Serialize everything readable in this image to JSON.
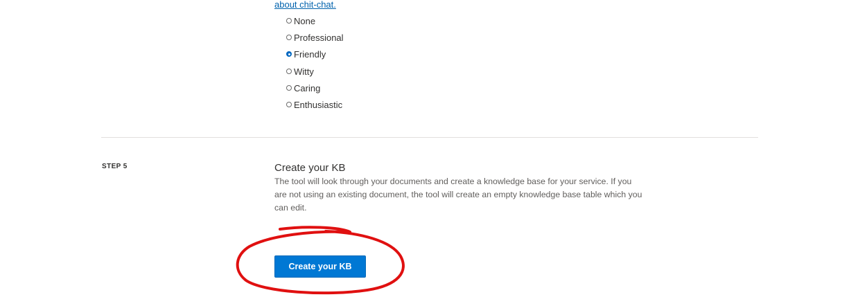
{
  "chit_chat": {
    "link_text": "about chit-chat.",
    "options": [
      {
        "label": "None",
        "checked": false
      },
      {
        "label": "Professional",
        "checked": false
      },
      {
        "label": "Friendly",
        "checked": true
      },
      {
        "label": "Witty",
        "checked": false
      },
      {
        "label": "Caring",
        "checked": false
      },
      {
        "label": "Enthusiastic",
        "checked": false
      }
    ]
  },
  "step5": {
    "step_label": "STEP 5",
    "title": "Create your KB",
    "description": "The tool will look through your documents and create a knowledge base for your service. If you are not using an existing document, the tool will create an empty knowledge base table which you can edit.",
    "button_label": "Create your KB"
  },
  "colors": {
    "primary": "#0078d4",
    "link": "#0062ad",
    "annotation": "#e01010"
  }
}
